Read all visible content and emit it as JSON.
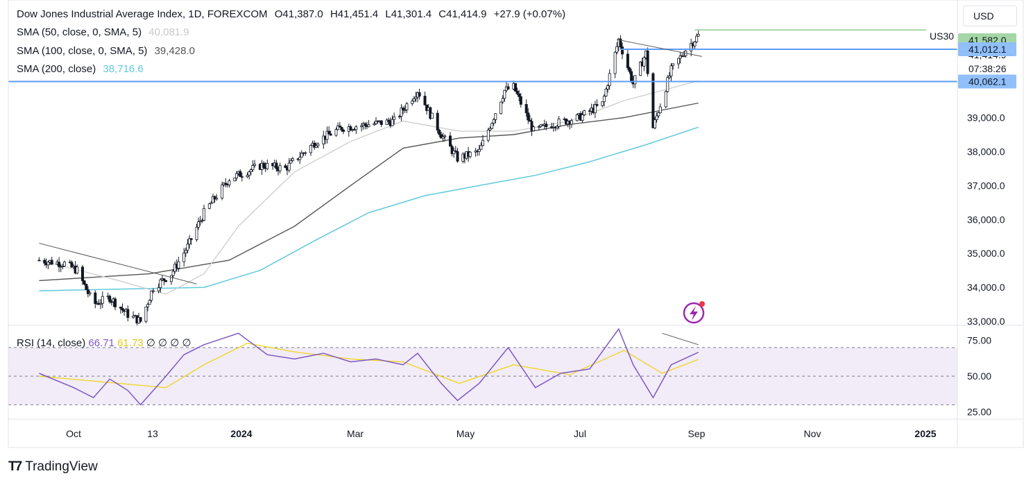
{
  "header": {
    "symbol": "Dow Jones Industrial Average Index, 1D, FOREXCOM",
    "open_label": "O",
    "open": "41,387.0",
    "high_label": "H",
    "high": "41,451.4",
    "low_label": "L",
    "low": "41,301.4",
    "close_label": "C",
    "close": "41,414.9",
    "change": "+27.9 (+0.07%)"
  },
  "indicators": {
    "sma50": {
      "label": "SMA (50, close, 0, SMA, 5)",
      "value": "40,081.9"
    },
    "sma100": {
      "label": "SMA (100, close, 0, SMA, 5)",
      "value": "39,428.0"
    },
    "sma200": {
      "label": "SMA (200, close)",
      "value": "38,716.6"
    }
  },
  "rsi": {
    "label": "RSI (14, close)",
    "value": "66.71",
    "ma_value": "61.73",
    "extra": "∅ ∅ ∅ ∅"
  },
  "currency": "USD",
  "brand": "TradingView",
  "icons": {
    "brand": "tradingview-logo-icon",
    "flash": "flash-icon"
  },
  "chart_data": [
    {
      "type": "candlestick",
      "symbol_tag": "US30",
      "x": [
        "Oct",
        "13",
        "2024",
        "Mar",
        "May",
        "Jul",
        "Sep",
        "Nov",
        "2025"
      ],
      "ylim": [
        32900,
        42300
      ],
      "yticks": [
        "39,000.0",
        "38,000.0",
        "37,000.0",
        "36,000.0",
        "35,000.0",
        "34,000.0",
        "33,000.0"
      ],
      "ytick_values": [
        39000,
        38000,
        37000,
        36000,
        35000,
        34000,
        33000
      ],
      "price_markers": [
        {
          "label": "41,582.0",
          "value": 41582,
          "color": "#a5d6a7"
        },
        {
          "label": "41,414.9",
          "value": 41415,
          "color": "none"
        },
        {
          "label": "07:38:26",
          "value": 41200,
          "color": "none"
        },
        {
          "label": "41,012.1",
          "value": 41012,
          "color": "#90bff9"
        },
        {
          "label": "40,062.1",
          "value": 40062,
          "color": "#90bff9"
        }
      ],
      "horizontal_lines": [
        {
          "value": 41582,
          "color": "#a5d6a7"
        },
        {
          "value": 41012,
          "color": "#5b9cf6"
        },
        {
          "value": 40062,
          "color": "#5b9cf6"
        }
      ],
      "close_path": [
        [
          "Sep 1 2023",
          34800
        ],
        [
          "Sep 15 2023",
          34700
        ],
        [
          "Sep 22 2023",
          34500
        ],
        [
          "Oct 1 2023",
          33500
        ],
        [
          "Oct 10 2023",
          33700
        ],
        [
          "Oct 20 2023",
          33200
        ],
        [
          "Oct 27 2023",
          33000
        ],
        [
          "Nov 3 2023",
          34000
        ],
        [
          "Nov 13 2023",
          34400
        ],
        [
          "Nov 22 2023",
          35200
        ],
        [
          "Dec 1 2023",
          36200
        ],
        [
          "Dec 15 2023",
          37200
        ],
        [
          "Jan 2 2024",
          37600
        ],
        [
          "Jan 15 2024",
          37500
        ],
        [
          "Feb 1 2024",
          38300
        ],
        [
          "Feb 15 2024",
          38700
        ],
        [
          "Mar 1 2024",
          38800
        ],
        [
          "Mar 15 2024",
          38900
        ],
        [
          "Mar 28 2024",
          39800
        ],
        [
          "Apr 10 2024",
          38500
        ],
        [
          "Apr 19 2024",
          37800
        ],
        [
          "May 1 2024",
          38000
        ],
        [
          "May 15 2024",
          39800
        ],
        [
          "May 20 2024",
          39900
        ],
        [
          "May 31 2024",
          38600
        ],
        [
          "Jun 10 2024",
          38800
        ],
        [
          "Jun 25 2024",
          39000
        ],
        [
          "Jul 8 2024",
          39400
        ],
        [
          "Jul 17 2024",
          41300
        ],
        [
          "Jul 25 2024",
          40000
        ],
        [
          "Aug 1 2024",
          40900
        ],
        [
          "Aug 5 2024",
          38700
        ],
        [
          "Aug 15 2024",
          40400
        ],
        [
          "Aug 23 2024",
          41000
        ],
        [
          "Aug 30 2024",
          41415
        ]
      ],
      "sma50": [
        [
          "Sep 1 2023",
          34800
        ],
        [
          "Oct 15 2023",
          34200
        ],
        [
          "Nov 10 2023",
          33800
        ],
        [
          "Dec 1 2023",
          34400
        ],
        [
          "Dec 20 2023",
          35800
        ],
        [
          "Jan 20 2024",
          37400
        ],
        [
          "Feb 20 2024",
          38300
        ],
        [
          "Mar 20 2024",
          38900
        ],
        [
          "Apr 20 2024",
          38600
        ],
        [
          "May 20 2024",
          38600
        ],
        [
          "Jun 20 2024",
          38900
        ],
        [
          "Jul 20 2024",
          39500
        ],
        [
          "Aug 30 2024",
          40082
        ]
      ],
      "sma100": [
        [
          "Sep 1 2023",
          34200
        ],
        [
          "Nov 1 2023",
          34400
        ],
        [
          "Dec 15 2023",
          34800
        ],
        [
          "Jan 20 2024",
          35800
        ],
        [
          "Feb 20 2024",
          37000
        ],
        [
          "Mar 20 2024",
          38100
        ],
        [
          "Apr 20 2024",
          38400
        ],
        [
          "May 20 2024",
          38500
        ],
        [
          "Jun 20 2024",
          38800
        ],
        [
          "Jul 20 2024",
          39000
        ],
        [
          "Aug 30 2024",
          39428
        ]
      ],
      "sma200": [
        [
          "Sep 1 2023",
          33900
        ],
        [
          "Dec 1 2023",
          34000
        ],
        [
          "Jan 1 2024",
          34500
        ],
        [
          "Feb 1 2024",
          35400
        ],
        [
          "Mar 1 2024",
          36200
        ],
        [
          "Apr 1 2024",
          36700
        ],
        [
          "May 1 2024",
          37000
        ],
        [
          "Jun 1 2024",
          37300
        ],
        [
          "Jul 1 2024",
          37700
        ],
        [
          "Aug 1 2024",
          38200
        ],
        [
          "Aug 30 2024",
          38717
        ]
      ],
      "trendlines": [
        {
          "from": [
            "Sep 1 2023",
            35300
          ],
          "to": [
            "Nov 27 2023",
            34100
          ]
        },
        {
          "from": [
            "Jul 16 2024",
            41300
          ],
          "to": [
            "Sep 1 2024",
            40800
          ]
        }
      ]
    },
    {
      "type": "line",
      "name": "RSI (14, close)",
      "ylim": [
        20,
        85
      ],
      "yticks": [
        "75.00",
        "50.00",
        "25.00"
      ],
      "ytick_values": [
        75,
        50,
        25
      ],
      "band": [
        30,
        70
      ],
      "rsi": [
        [
          "Sep 1 2023",
          52
        ],
        [
          "Sep 20 2023",
          42
        ],
        [
          "Oct 1 2023",
          35
        ],
        [
          "Oct 10 2023",
          48
        ],
        [
          "Oct 20 2023",
          40
        ],
        [
          "Oct 27 2023",
          30
        ],
        [
          "Nov 10 2023",
          50
        ],
        [
          "Nov 20 2023",
          65
        ],
        [
          "Dec 1 2023",
          72
        ],
        [
          "Dec 20 2023",
          80
        ],
        [
          "Jan 5 2024",
          65
        ],
        [
          "Jan 20 2024",
          62
        ],
        [
          "Feb 5 2024",
          66
        ],
        [
          "Feb 20 2024",
          60
        ],
        [
          "Mar 5 2024",
          62
        ],
        [
          "Mar 20 2024",
          58
        ],
        [
          "Mar 28 2024",
          66
        ],
        [
          "Apr 10 2024",
          45
        ],
        [
          "Apr 19 2024",
          33
        ],
        [
          "May 1 2024",
          45
        ],
        [
          "May 17 2024",
          70
        ],
        [
          "Jun 1 2024",
          42
        ],
        [
          "Jun 15 2024",
          52
        ],
        [
          "Jul 1 2024",
          55
        ],
        [
          "Jul 17 2024",
          83
        ],
        [
          "Jul 25 2024",
          58
        ],
        [
          "Aug 5 2024",
          35
        ],
        [
          "Aug 15 2024",
          58
        ],
        [
          "Aug 30 2024",
          66.71
        ]
      ],
      "rsi_ma": [
        [
          "Sep 1 2023",
          50
        ],
        [
          "Oct 15 2023",
          45
        ],
        [
          "Nov 10 2023",
          42
        ],
        [
          "Dec 1 2023",
          58
        ],
        [
          "Dec 25 2023",
          73
        ],
        [
          "Jan 20 2024",
          67
        ],
        [
          "Feb 20 2024",
          62
        ],
        [
          "Mar 20 2024",
          60
        ],
        [
          "Apr 20 2024",
          45
        ],
        [
          "May 20 2024",
          58
        ],
        [
          "Jun 20 2024",
          51
        ],
        [
          "Jul 20 2024",
          68
        ],
        [
          "Aug 10 2024",
          52
        ],
        [
          "Aug 30 2024",
          61.73
        ]
      ],
      "trendline": {
        "from": [
          "Aug 10 2024",
          80
        ],
        "to": [
          "Aug 30 2024",
          72
        ]
      }
    }
  ]
}
